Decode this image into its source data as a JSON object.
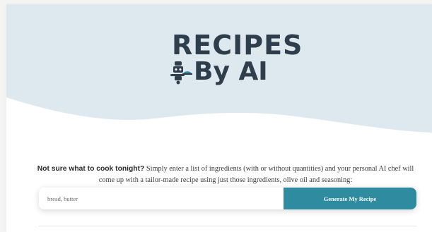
{
  "brand": {
    "line1": "RECIPES",
    "line2": "By AI",
    "logo_icon": "chef-robot-icon",
    "text_color": "#2f3e4c",
    "hero_color": "#dde9ee"
  },
  "intro": {
    "bold_text": "Not sure what to cook tonight?",
    "body_text": " Simply enter a list of ingredients (with or without quantities) and your personal AI chef will come up with a tailor-made recipe using just those ingredients, olive oil and seasoning:"
  },
  "form": {
    "ingredients_value": "bread, butter",
    "generate_label": "Generate My Recipe",
    "button_color": "#2f8ba0"
  }
}
